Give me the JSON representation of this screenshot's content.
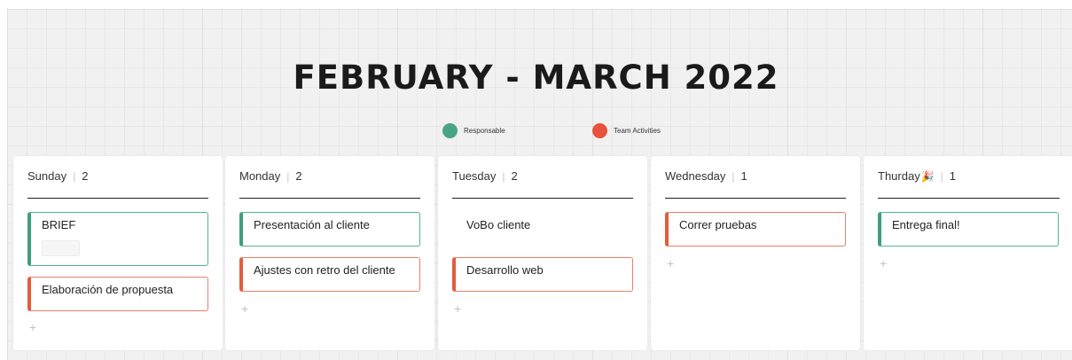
{
  "title": "FEBRUARY - MARCH 2022",
  "legend": [
    {
      "label": "Responsable",
      "color": "#4aa586"
    },
    {
      "label": "Team Activities",
      "color": "#e8523a"
    }
  ],
  "add_label": "+",
  "columns": [
    {
      "day": "Sunday",
      "count": "2",
      "cards": [
        {
          "text": "BRIEF",
          "type": "green"
        },
        {
          "text": "Elaboración de propuesta",
          "type": "red"
        }
      ]
    },
    {
      "day": "Monday",
      "count": "2",
      "cards": [
        {
          "text": "Presentación al cliente",
          "type": "green"
        },
        {
          "text": "Ajustes con retro del cliente",
          "type": "red"
        }
      ]
    },
    {
      "day": "Tuesday",
      "count": "2",
      "cards": [
        {
          "text": "VoBo cliente",
          "type": "plain"
        },
        {
          "text": "Desarrollo web",
          "type": "red"
        }
      ]
    },
    {
      "day": "Wednesday",
      "count": "1",
      "cards": [
        {
          "text": "Correr pruebas",
          "type": "red"
        }
      ]
    },
    {
      "day": "Thurday",
      "day_icon": "party-popper-icon",
      "count": "1",
      "cards": [
        {
          "text": "Entrega final!",
          "type": "green"
        }
      ]
    }
  ]
}
